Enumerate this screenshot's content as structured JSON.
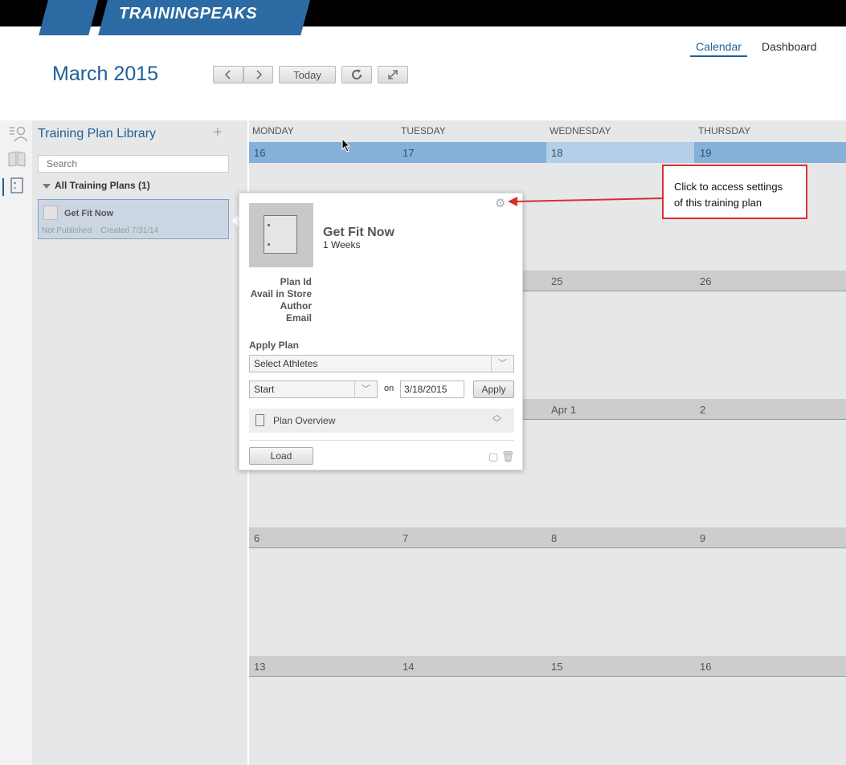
{
  "brand": {
    "logo_text": "TRAININGPEAKS"
  },
  "header": {
    "month": "March",
    "year": "2015",
    "buttons": {
      "today": "Today"
    },
    "tabs": [
      {
        "label": "Calendar",
        "active": true
      },
      {
        "label": "Dashboard",
        "active": false
      }
    ]
  },
  "library": {
    "title": "Training Plan Library",
    "search_placeholder": "Search",
    "group_label": "All Training Plans (1)",
    "plans": [
      {
        "name": "Get Fit Now",
        "status": "Not Published",
        "created": "Created 7/31/14"
      }
    ]
  },
  "calendar": {
    "day_names": [
      "MONDAY",
      "TUESDAY",
      "WEDNESDAY",
      "THURSDAY"
    ],
    "weeks": [
      [
        "16",
        "17",
        "18",
        "19"
      ],
      [
        "",
        "",
        "25",
        "26"
      ],
      [
        "",
        "",
        "Apr 1",
        "2"
      ],
      [
        "6",
        "7",
        "8",
        "9"
      ],
      [
        "13",
        "14",
        "15",
        "16"
      ]
    ]
  },
  "popover": {
    "title": "Get Fit Now",
    "duration": "1 Weeks",
    "fields": [
      "Plan Id",
      "Avail in Store",
      "Author",
      "Email"
    ],
    "apply_label": "Apply Plan",
    "athlete_select": "Select Athletes",
    "start_select": "Start",
    "on_label": "on",
    "date_value": "3/18/2015",
    "apply_button": "Apply",
    "overview_label": "Plan Overview",
    "load_button": "Load"
  },
  "callout": {
    "line1": "Click to access settings",
    "line2": "of this training plan"
  },
  "colors": {
    "brand_blue": "#2c6aa3",
    "title_blue": "#1f5f97",
    "current_week": "#85b1d9",
    "callout_red": "#d9302b"
  }
}
